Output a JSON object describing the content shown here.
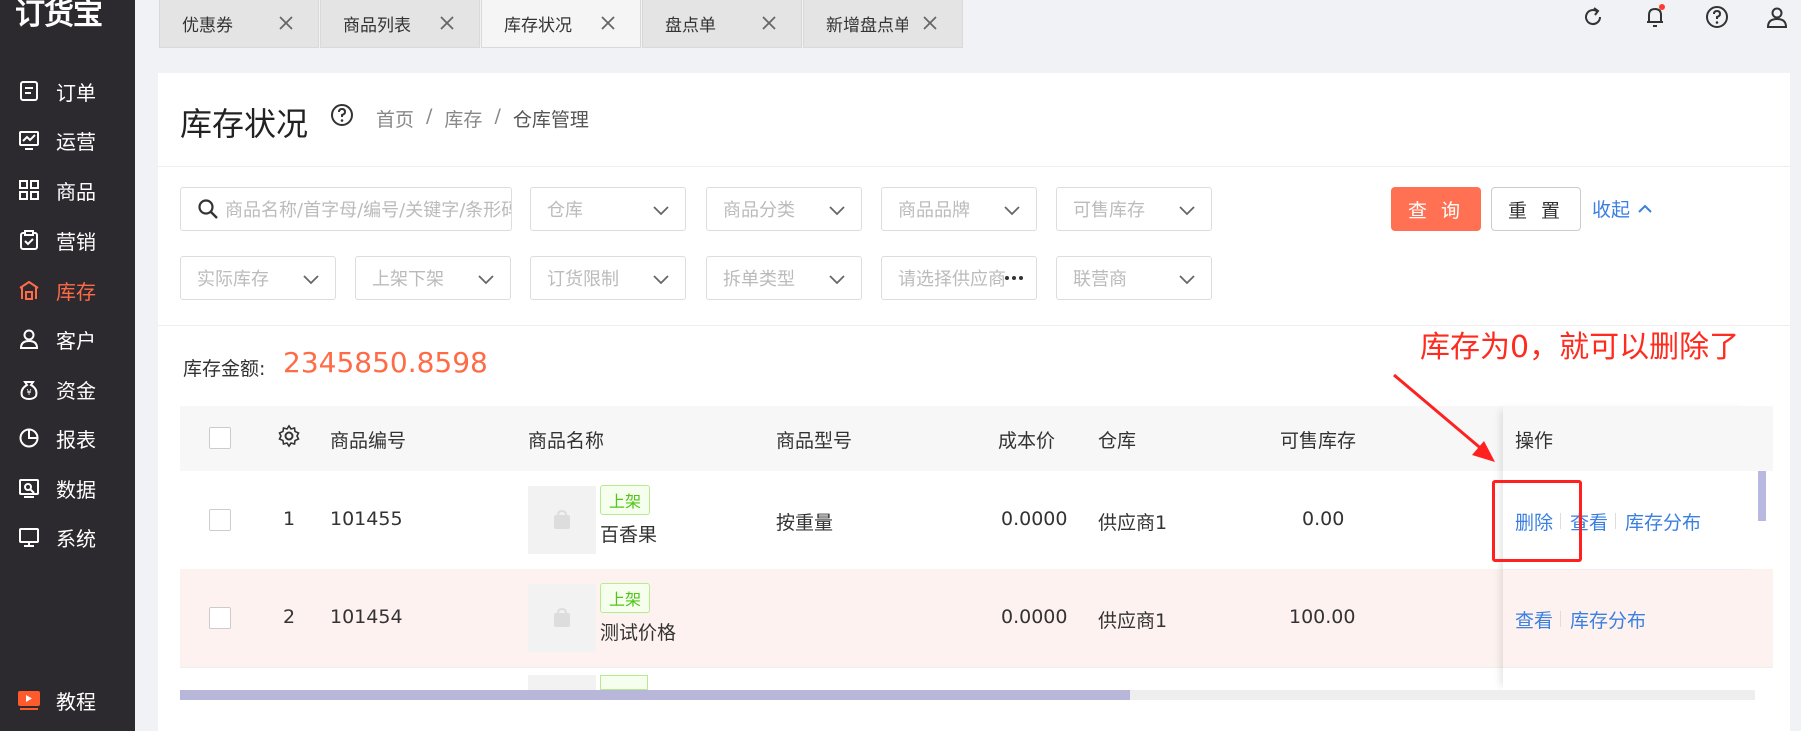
{
  "app": {
    "logo": "订货宝"
  },
  "sidebar": {
    "items": [
      {
        "label": "订单",
        "icon": "order-icon"
      },
      {
        "label": "运营",
        "icon": "operation-icon"
      },
      {
        "label": "商品",
        "icon": "goods-icon"
      },
      {
        "label": "营销",
        "icon": "marketing-icon"
      },
      {
        "label": "库存",
        "icon": "inventory-icon",
        "active": true
      },
      {
        "label": "客户",
        "icon": "customer-icon"
      },
      {
        "label": "资金",
        "icon": "funds-icon"
      },
      {
        "label": "报表",
        "icon": "report-icon"
      },
      {
        "label": "数据",
        "icon": "data-icon"
      },
      {
        "label": "系统",
        "icon": "system-icon"
      },
      {
        "label": "教程",
        "icon": "tutorial-icon"
      }
    ]
  },
  "tabs": [
    {
      "label": "优惠券"
    },
    {
      "label": "商品列表"
    },
    {
      "label": "库存状况",
      "active": true
    },
    {
      "label": "盘点单"
    },
    {
      "label": "新增盘点单"
    }
  ],
  "page": {
    "title": "库存状况",
    "breadcrumb": [
      "首页",
      "/",
      "库存",
      "/",
      "仓库管理"
    ]
  },
  "filters": {
    "search_placeholder": "商品名称/首字母/编号/关键字/条形码",
    "row1": [
      "仓库",
      "商品分类",
      "商品品牌",
      "可售库存"
    ],
    "row2": [
      "实际库存",
      "上架下架",
      "订货限制",
      "拆单类型",
      "请选择供应商",
      "联营商"
    ],
    "query_label": "查 询",
    "reset_label": "重 置",
    "collapse_label": "收起"
  },
  "summary": {
    "amount_label": "库存金额:",
    "amount_value": "2345850.8598"
  },
  "table": {
    "headers": {
      "code": "商品编号",
      "name": "商品名称",
      "model": "商品型号",
      "cost": "成本价",
      "warehouse": "仓库",
      "sellable": "可售库存",
      "ops": "操作"
    },
    "rows": [
      {
        "index": "1",
        "code": "101455",
        "tag": "上架",
        "name": "百香果",
        "model": "按重量",
        "cost": "0.0000",
        "warehouse": "供应商1",
        "sellable": "0.00",
        "ops": [
          "删除",
          "查看",
          "库存分布"
        ]
      },
      {
        "index": "2",
        "code": "101454",
        "tag": "上架",
        "name": "测试价格",
        "model": "",
        "cost": "0.0000",
        "warehouse": "供应商1",
        "sellable": "100.00",
        "ops": [
          "查看",
          "库存分布"
        ]
      }
    ]
  },
  "annotation": {
    "text": "库存为0，就可以删除了"
  },
  "colors": {
    "accent": "#ff6b47",
    "link": "#3b7fe0",
    "sidebar": "#2c2a2e",
    "annotation": "#ff2b1f"
  }
}
